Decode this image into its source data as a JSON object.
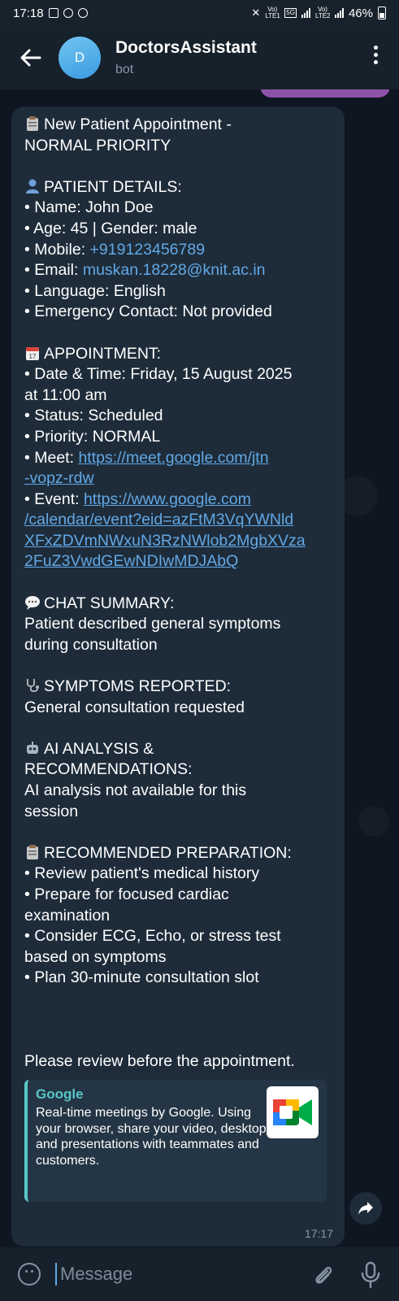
{
  "status_bar": {
    "time": "17:18",
    "battery": "46%",
    "net_5g": "5G",
    "lte1": "Vo) LTE1",
    "lte2": "Vo) LTE2"
  },
  "header": {
    "avatar_letter": "D",
    "title": "DoctorsAssistant",
    "subtitle": "bot"
  },
  "message": {
    "line01": "New Patient Appointment -",
    "line02": "NORMAL PRIORITY",
    "patient_heading": "PATIENT DETAILS:",
    "name": "• Name: John Doe",
    "age_gender": "• Age: 45 | Gender: male",
    "mobile_label": "• Mobile: ",
    "mobile_value": "+919123456789",
    "email_label": "• Email: ",
    "email_value": "muskan.18228@knit.ac.in",
    "language": "• Language: English",
    "emergency": "• Emergency Contact: Not provided",
    "appointment_heading": "APPOINTMENT:",
    "datetime_1": "• Date & Time: Friday, 15 August 2025",
    "datetime_2": "at 11:00 am",
    "status": "• Status: Scheduled",
    "priority": "• Priority: NORMAL",
    "meet_label": "• Meet: ",
    "meet_link_1": "https://meet.google.com/jtn",
    "meet_link_2": "-vopz-rdw",
    "event_label": "• Event: ",
    "event_link_1": "https://www.google.com",
    "event_link_2": "/calendar/event?eid=azFtM3VqYWNld",
    "event_link_3": "XFxZDVmNWxuN3RzNWlob2MgbXVza",
    "event_link_4": "2FuZ3VwdGEwNDIwMDJAbQ",
    "chat_heading": "CHAT SUMMARY:",
    "chat_1": "Patient described general symptoms",
    "chat_2": "during consultation",
    "symptoms_heading": "SYMPTOMS REPORTED:",
    "symptoms_1": "General consultation requested",
    "ai_heading_1": "AI ANALYSIS &",
    "ai_heading_2": "RECOMMENDATIONS:",
    "ai_1": "AI analysis not available for this",
    "ai_2": "session",
    "prep_heading": "RECOMMENDED PREPARATION:",
    "prep_1": "• Review patient's medical history",
    "prep_2a": "• Prepare for focused cardiac",
    "prep_2b": "examination",
    "prep_3a": "• Consider ECG, Echo, or stress test",
    "prep_3b": "based on symptoms",
    "prep_4": "• Plan 30-minute consultation slot",
    "closing": "Please review before the appointment.",
    "time": "17:17"
  },
  "link_preview": {
    "site": "Google",
    "description": "Real-time meetings by Google. Using your browser, share your video, desktop, and presentations with teammates and customers."
  },
  "input": {
    "placeholder": "Message"
  },
  "icons": {
    "clipboard": "clipboard-icon",
    "person": "person-icon",
    "calendar": "calendar-icon",
    "speech": "speech-bubble-icon",
    "stethoscope": "stethoscope-icon",
    "robot": "robot-icon"
  },
  "colors": {
    "background": "#0e1621",
    "bubble": "#1e2c3a",
    "header": "#17212b",
    "link": "#62a8e5",
    "preview_accent": "#58c7c7"
  }
}
